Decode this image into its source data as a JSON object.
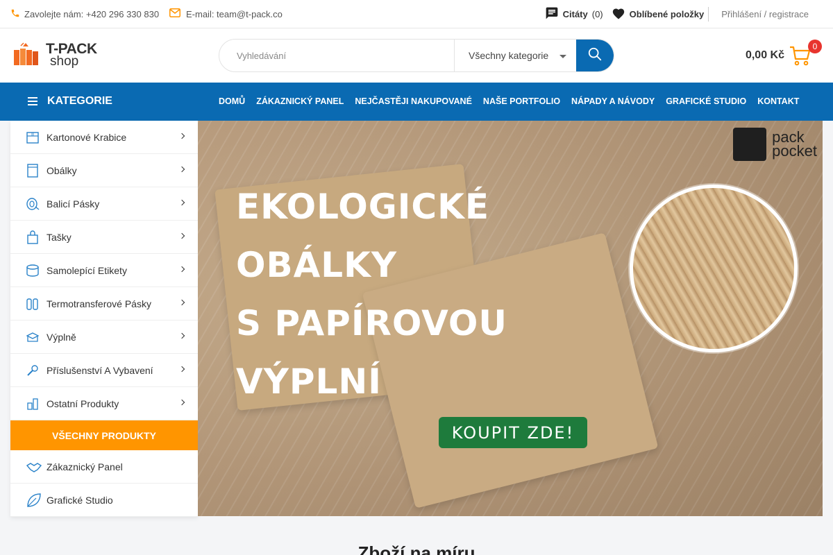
{
  "topbar": {
    "phone": "Zavolejte nám: +420 296 330 830",
    "email": "E-mail: team@t-pack.co",
    "quotes_label": "Citáty",
    "quotes_count": "(0)",
    "favorites_label": "Oblíbené položky",
    "auth": "Přihlášení / registrace"
  },
  "logo": {
    "line1": "T-PACK",
    "line2": "shop"
  },
  "search": {
    "placeholder": "Vyhledávání",
    "category": "Všechny kategorie"
  },
  "cart": {
    "total": "0,00 Kč",
    "count": "0"
  },
  "nav": {
    "categories_label": "KATEGORIE",
    "links": [
      "DOMŮ",
      "ZÁKAZNICKÝ PANEL",
      "NEJČASTĚJI NAKUPOVANÉ",
      "NAŠE PORTFOLIO",
      "NÁPADY A NÁVODY",
      "GRAFICKÉ STUDIO",
      "KONTAKT"
    ]
  },
  "sidebar": {
    "items": [
      {
        "label": "Kartonové Krabice",
        "icon": "box-icon"
      },
      {
        "label": "Obálky",
        "icon": "envelope-icon"
      },
      {
        "label": "Balicí Pásky",
        "icon": "tape-icon"
      },
      {
        "label": "Tašky",
        "icon": "bag-icon"
      },
      {
        "label": "Samolepící Etikety",
        "icon": "label-roll-icon"
      },
      {
        "label": "Termotransferové Pásky",
        "icon": "ribbon-icon"
      },
      {
        "label": "Výplně",
        "icon": "filler-icon"
      },
      {
        "label": "Příslušenství A Vybavení",
        "icon": "tools-icon"
      },
      {
        "label": "Ostatní Produkty",
        "icon": "products-icon"
      }
    ],
    "all_products": "VŠECHNY PRODUKTY",
    "extras": [
      {
        "label": "Zákaznický Panel",
        "icon": "handshake-icon"
      },
      {
        "label": "Grafické Studio",
        "icon": "leaf-icon"
      }
    ]
  },
  "banner": {
    "lines": [
      "EKOLOGICKÉ",
      "OBÁLKY",
      "S PAPÍROVOU",
      "VÝPLNÍ"
    ],
    "cta": "KOUPIT ZDE!",
    "brand_line1": "pack",
    "brand_line2": "pocket"
  },
  "section": {
    "title": "Zboží na míru"
  },
  "colors": {
    "primary": "#0a6ab2",
    "accent": "#ff9500",
    "badge": "#e8342e",
    "cta": "#1e7b3c"
  }
}
